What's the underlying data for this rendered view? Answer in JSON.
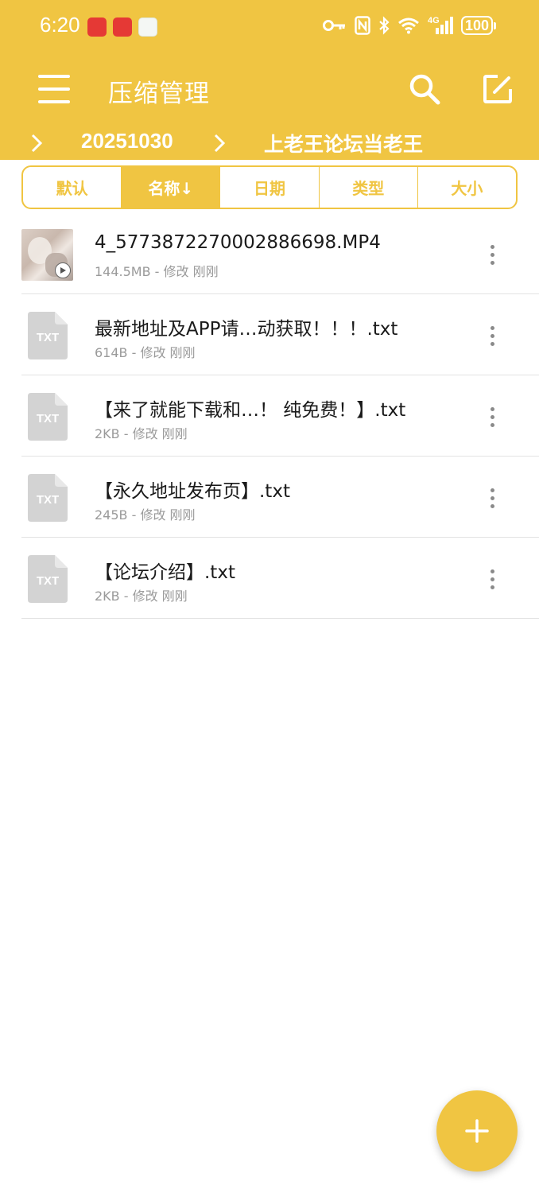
{
  "status_bar": {
    "time": "6:20",
    "battery": "100",
    "network": "4G"
  },
  "app_bar": {
    "title": "压缩管理"
  },
  "breadcrumb": {
    "items": [
      "20251030",
      "上老王论坛当老王"
    ]
  },
  "sort_tabs": [
    {
      "label": "默认",
      "active": false
    },
    {
      "label": "名称↓",
      "active": true
    },
    {
      "label": "日期",
      "active": false
    },
    {
      "label": "类型",
      "active": false
    },
    {
      "label": "大小",
      "active": false
    }
  ],
  "files": [
    {
      "name": "4_5773872270002886698.MP4",
      "meta": "144.5MB - 修改 刚刚",
      "icon": "video-thumbnail"
    },
    {
      "name": "最新地址及APP请…动获取！！！.txt",
      "meta": "614B - 修改 刚刚",
      "icon": "txt-file-icon",
      "icon_label": "TXT"
    },
    {
      "name": "【来了就能下载和…！ 纯免费！】.txt",
      "meta": "2KB - 修改 刚刚",
      "icon": "txt-file-icon",
      "icon_label": "TXT"
    },
    {
      "name": "【永久地址发布页】.txt",
      "meta": "245B - 修改 刚刚",
      "icon": "txt-file-icon",
      "icon_label": "TXT"
    },
    {
      "name": "【论坛介绍】.txt",
      "meta": "2KB - 修改 刚刚",
      "icon": "txt-file-icon",
      "icon_label": "TXT"
    }
  ],
  "colors": {
    "accent": "#F0C542",
    "divider": "#e2e2e2",
    "meta_text": "#9a9a9a"
  }
}
